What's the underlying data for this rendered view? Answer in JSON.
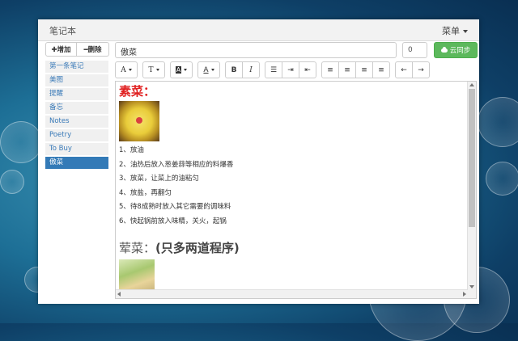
{
  "app": {
    "title": "笔记本",
    "menu_label": "菜单"
  },
  "actions": {
    "add_label": "✚增加",
    "delete_label": "━删除",
    "sync_label": "云同步"
  },
  "note": {
    "title": "傲菜",
    "count": "0"
  },
  "sidebar": {
    "items": [
      {
        "label": "第一条笔记",
        "active": false
      },
      {
        "label": "美图",
        "active": false
      },
      {
        "label": "提醒",
        "active": false
      },
      {
        "label": "备忘",
        "active": false
      },
      {
        "label": "Notes",
        "active": false
      },
      {
        "label": "Poetry",
        "active": false
      },
      {
        "label": "To Buy",
        "active": false
      },
      {
        "label": "傲菜",
        "active": true
      }
    ]
  },
  "toolbar": {
    "font_name": "A",
    "font_size": "T",
    "bg_color": "A",
    "fore_color": "A",
    "bold": "B",
    "italic": "I",
    "unordered_list": "☰",
    "indent": "⇥",
    "outdent": "⇤",
    "align_left": "≡",
    "align_center": "≡",
    "align_right": "≡",
    "align_justify": "≡",
    "undo": "←",
    "redo": "→"
  },
  "content": {
    "heading1": "素菜：",
    "steps": [
      "1、放油",
      "2、油热后放入葱姜蒜等相应的料爆香",
      "3、放菜，让菜上的油粘匀",
      "4、放盐，再翻匀",
      "5、待8成熟时放入其它需要的调味料",
      "6、快起锅前放入味精，关火，起锅"
    ],
    "heading2_prefix": "荤菜：",
    "heading2_bold": "(只多两道程序)"
  },
  "colors": {
    "accent": "#337ab7",
    "sync_green": "#5cb85c",
    "heading_red": "#e02020"
  }
}
